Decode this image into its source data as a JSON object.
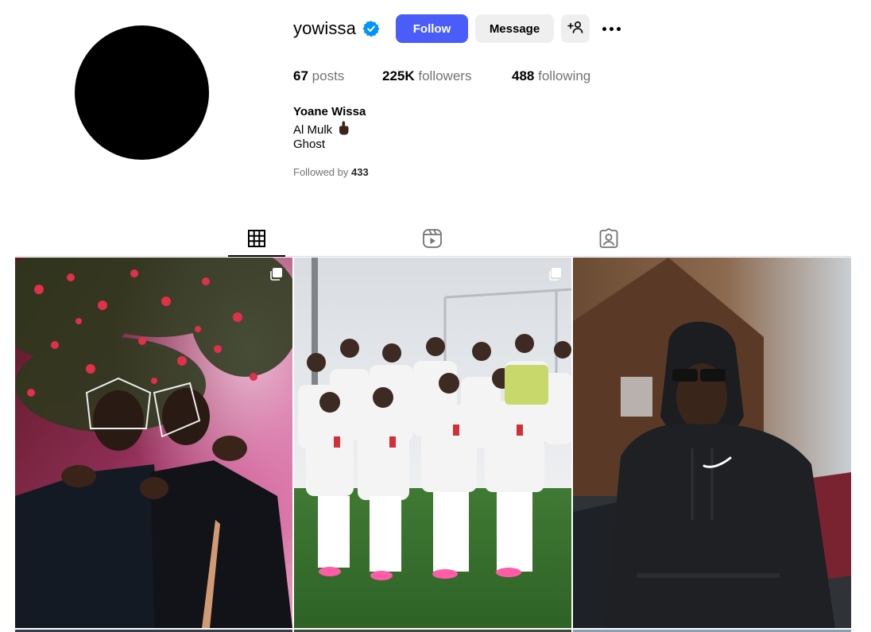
{
  "profile": {
    "username": "yowissa",
    "full_name": "Yoane Wissa",
    "bio_line1": "Al Mulk",
    "bio_line2": "Ghost",
    "verified": true,
    "accent_color": "#4a5df9",
    "verified_color": "#0095f6"
  },
  "actions": {
    "follow_label": "Follow",
    "message_label": "Message"
  },
  "stats": {
    "posts_count": "67",
    "posts_label": "posts",
    "followers_count": "225K",
    "followers_label": "followers",
    "following_count": "488",
    "following_label": "following"
  },
  "followed_by": {
    "prefix": "Followed by",
    "name": "433"
  },
  "tabs": [
    {
      "name": "posts",
      "icon": "grid-icon",
      "active": true
    },
    {
      "name": "reels",
      "icon": "reels-icon",
      "active": false
    },
    {
      "name": "tagged",
      "icon": "tagged-icon",
      "active": false
    }
  ],
  "grid": [
    {
      "kind": "photo",
      "multi": true,
      "subject": "two men in black shirts at a party under red flowers"
    },
    {
      "kind": "photo",
      "multi": true,
      "subject": "football team in white kits posing on a pitch"
    },
    {
      "kind": "photo",
      "multi": false,
      "subject": "man in black hoodie and sunglasses outdoors"
    }
  ]
}
